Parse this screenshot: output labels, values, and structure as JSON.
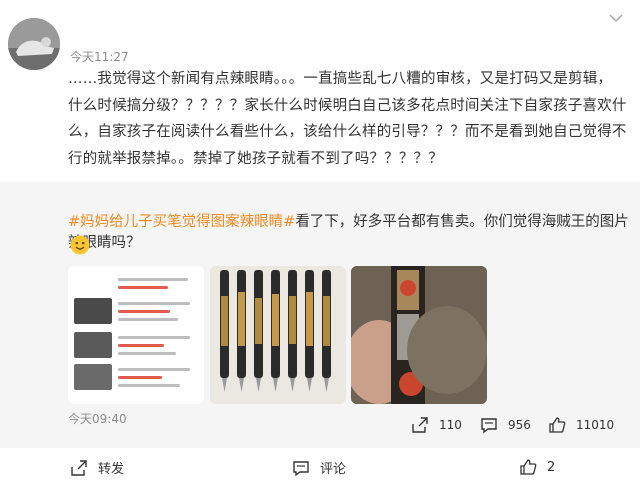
{
  "post": {
    "time": "今天11:27",
    "lines": [
      "……我觉得这个新闻有点辣眼睛。。。一直搞些乱七八糟的审核，又是打码又是剪辑，",
      "什么时候搞分级？？？？？家长什么时候明白自己该多花点时间关注下自家孩子喜欢什",
      "么，自家孩子在阅读什么看些什么，该给什么样的引导？？？而不是看到她自己觉得不",
      "行的就举报禁掉。。禁掉了她孩子就看不到了吗？？？？？"
    ]
  },
  "repost": {
    "tag": "#妈妈给儿子买笔觉得图案辣眼睛#",
    "text": "看了下，好多平台都有售卖。你们觉得海贼王的图片辣眼睛吗？",
    "time": "今天09:40",
    "stats": {
      "share": "110",
      "comment": "956",
      "like": "11010"
    }
  },
  "actions": {
    "forward": "转发",
    "comment": "评论",
    "like": "2"
  },
  "icons": [
    "avatar",
    "more-chevron-icon",
    "smile-emoji-icon",
    "share-icon",
    "comment-icon",
    "like-icon"
  ],
  "colors": {
    "tag": "#f08a23",
    "background": "#f5f5f5"
  }
}
